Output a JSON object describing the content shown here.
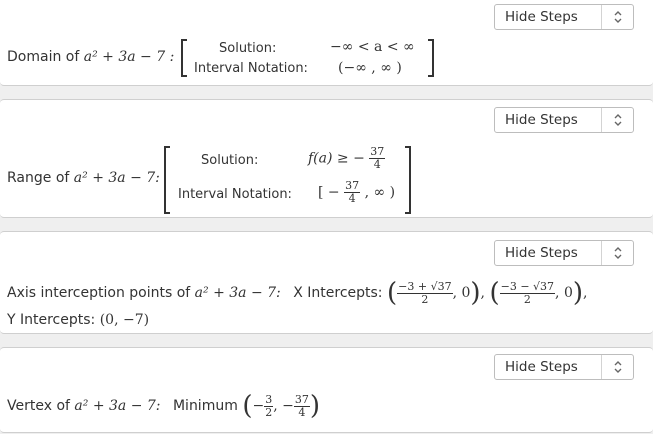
{
  "domain": {
    "label": "Domain of",
    "expr": "a² + 3a − 7 :",
    "solution_label": "Solution:",
    "solution_value": "−∞ < a < ∞",
    "interval_label": "Interval Notation:",
    "interval_value": "(−∞ , ∞ )",
    "button": "Hide Steps"
  },
  "range": {
    "label": "Range of",
    "expr": "a² + 3a − 7:",
    "solution_label": "Solution:",
    "solution_value_prefix": "f(a) ≥ −",
    "frac_num": "37",
    "frac_den": "4",
    "interval_label": "Interval Notation:",
    "interval_prefix": "[ −",
    "interval_suffix": ", ∞ )",
    "button": "Hide Steps"
  },
  "axis": {
    "label": "Axis interception points of",
    "expr": "a² + 3a − 7:",
    "x_label": "X Intercepts:",
    "x1_num": "−3 + √37",
    "x1_den": "2",
    "x2_num": "−3 − √37",
    "x2_den": "2",
    "y_label": "Y Intercepts:",
    "y_value": "(0, −7)",
    "button": "Hide Steps"
  },
  "vertex": {
    "label": "Vertex of",
    "expr": "a² + 3a − 7:",
    "kind": "Minimum",
    "x_num": "3",
    "x_den": "2",
    "y_num": "37",
    "y_den": "4",
    "button": "Hide Steps"
  }
}
